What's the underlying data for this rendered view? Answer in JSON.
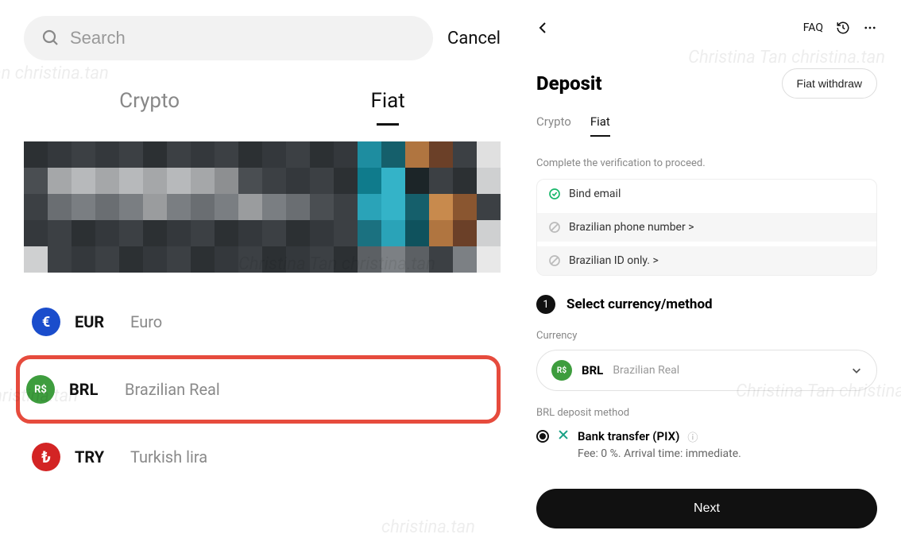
{
  "left": {
    "search_placeholder": "Search",
    "cancel": "Cancel",
    "tabs": {
      "crypto": "Crypto",
      "fiat": "Fiat",
      "active": "fiat"
    },
    "currencies": [
      {
        "code": "EUR",
        "name": "Euro",
        "symbol": "€",
        "bg": "#1a4dcc",
        "highlight": false
      },
      {
        "code": "BRL",
        "name": "Brazilian Real",
        "symbol": "R$",
        "bg": "#3e9d3e",
        "highlight": true
      },
      {
        "code": "TRY",
        "name": "Turkish lira",
        "symbol": "₺",
        "bg": "#d32424",
        "highlight": false
      }
    ]
  },
  "right": {
    "faq": "FAQ",
    "title": "Deposit",
    "fiat_withdraw": "Fiat withdraw",
    "tabs": {
      "crypto": "Crypto",
      "fiat": "Fiat",
      "active": "fiat"
    },
    "verification_hint": "Complete the verification to proceed.",
    "verification": [
      {
        "label": "Bind email",
        "status": "done",
        "chevron": ""
      },
      {
        "label": "Brazilian phone number",
        "status": "pending",
        "chevron": " >"
      },
      {
        "label": "Brazilian ID only.",
        "status": "pending",
        "chevron": " >"
      }
    ],
    "step": {
      "num": "1",
      "title": "Select currency/method"
    },
    "currency_label": "Currency",
    "currency_select": {
      "code": "BRL",
      "name": "Brazilian Real",
      "symbol": "R$"
    },
    "method_label": "BRL deposit method",
    "method": {
      "name": "Bank transfer (PIX)",
      "fee_line": "Fee: 0 %. Arrival time: immediate."
    },
    "next": "Next"
  },
  "watermarks": [
    "Christina Tan",
    "christina.tan"
  ]
}
